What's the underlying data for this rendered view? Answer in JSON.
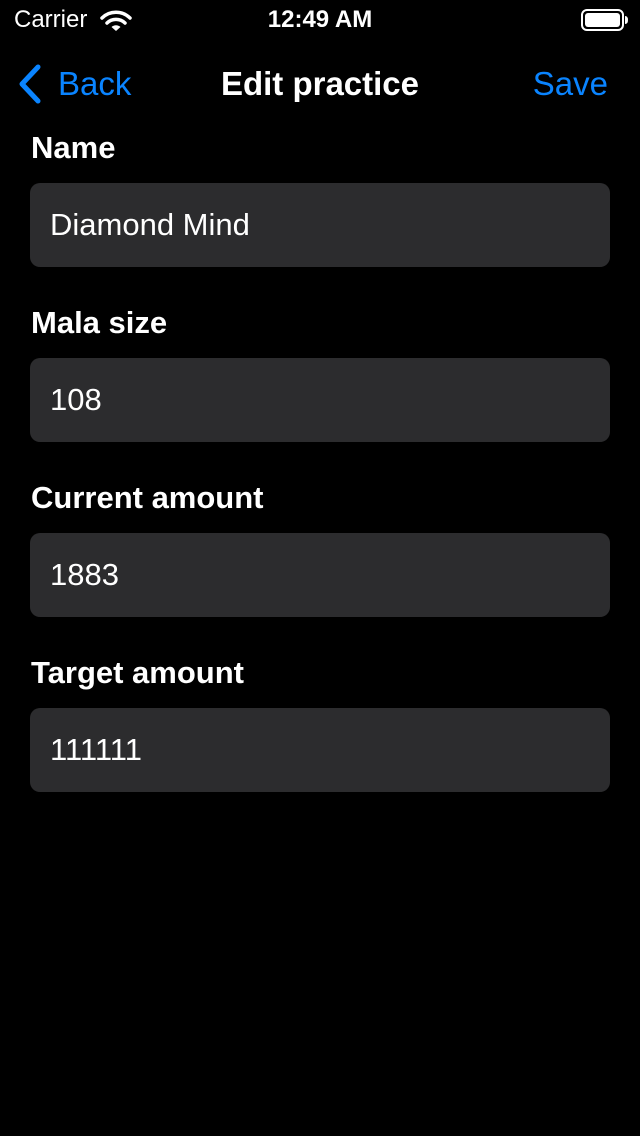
{
  "status_bar": {
    "carrier": "Carrier",
    "time": "12:49 AM",
    "wifi_icon": "wifi-icon",
    "battery_icon": "battery-icon"
  },
  "nav": {
    "back_label": "Back",
    "title": "Edit practice",
    "save_label": "Save",
    "accent_color": "#0a84ff"
  },
  "form": {
    "fields": [
      {
        "label": "Name",
        "value": "Diamond Mind"
      },
      {
        "label": "Mala size",
        "value": "108"
      },
      {
        "label": "Current amount",
        "value": "1883"
      },
      {
        "label": "Target amount",
        "value": "111111"
      }
    ]
  },
  "colors": {
    "background": "#000000",
    "field_background": "#2c2c2e",
    "text": "#ffffff"
  }
}
